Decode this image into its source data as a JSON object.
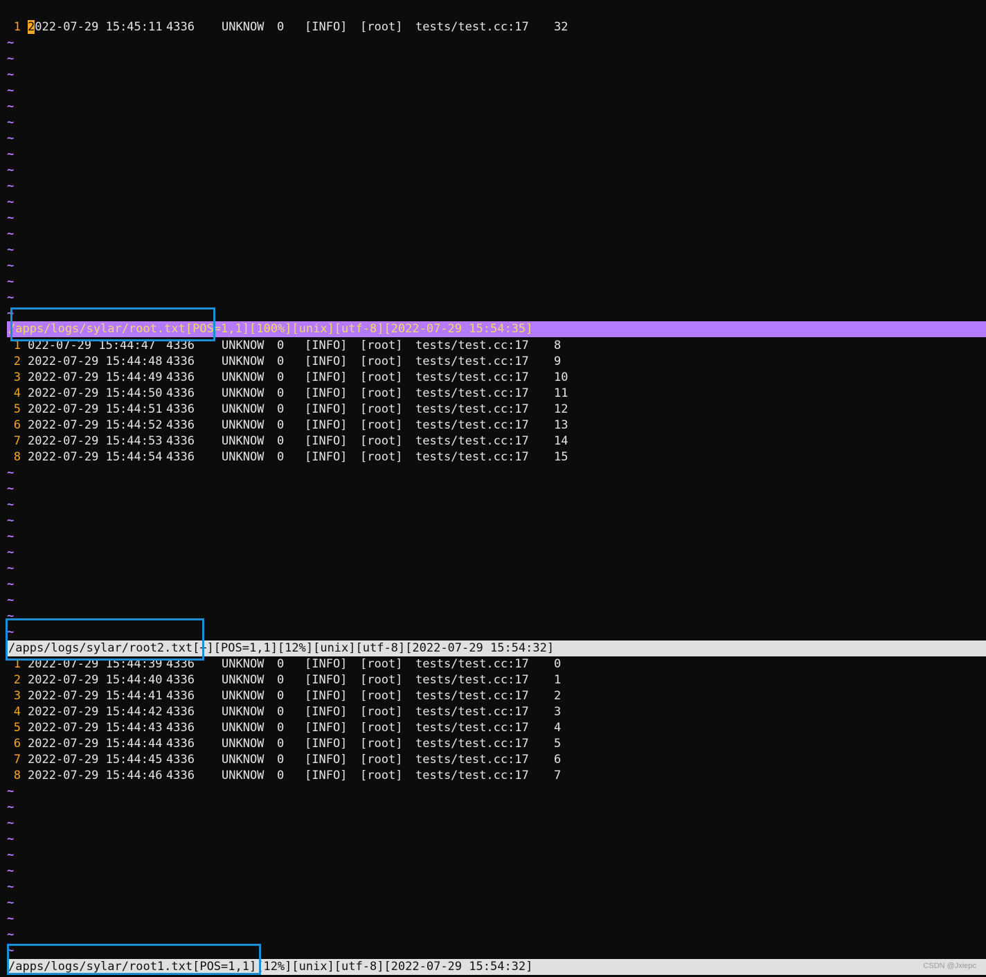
{
  "panes": [
    {
      "id": "top",
      "lines": [
        {
          "num": "1",
          "ts": "2022-07-29 15:45:11",
          "tid": "4336",
          "name": "UNKNOW",
          "zero": "0",
          "level": "[INFO]",
          "logger": "[root]",
          "file": "tests/test.cc:17",
          "val": "32"
        }
      ],
      "status": "/apps/logs/sylar/root.txt[POS=1,1][100%][unix][utf-8][2022-07-29 15:54:35]"
    },
    {
      "id": "middle",
      "lines": [
        {
          "num": "1",
          "ts": "022-07-29 15:44:47",
          "tid": "4336",
          "name": "UNKNOW",
          "zero": "0",
          "level": "[INFO]",
          "logger": "[root]",
          "file": "tests/test.cc:17",
          "val": "8"
        },
        {
          "num": "2",
          "ts": "2022-07-29 15:44:48",
          "tid": "4336",
          "name": "UNKNOW",
          "zero": "0",
          "level": "[INFO]",
          "logger": "[root]",
          "file": "tests/test.cc:17",
          "val": "9"
        },
        {
          "num": "3",
          "ts": "2022-07-29 15:44:49",
          "tid": "4336",
          "name": "UNKNOW",
          "zero": "0",
          "level": "[INFO]",
          "logger": "[root]",
          "file": "tests/test.cc:17",
          "val": "10"
        },
        {
          "num": "4",
          "ts": "2022-07-29 15:44:50",
          "tid": "4336",
          "name": "UNKNOW",
          "zero": "0",
          "level": "[INFO]",
          "logger": "[root]",
          "file": "tests/test.cc:17",
          "val": "11"
        },
        {
          "num": "5",
          "ts": "2022-07-29 15:44:51",
          "tid": "4336",
          "name": "UNKNOW",
          "zero": "0",
          "level": "[INFO]",
          "logger": "[root]",
          "file": "tests/test.cc:17",
          "val": "12"
        },
        {
          "num": "6",
          "ts": "2022-07-29 15:44:52",
          "tid": "4336",
          "name": "UNKNOW",
          "zero": "0",
          "level": "[INFO]",
          "logger": "[root]",
          "file": "tests/test.cc:17",
          "val": "13"
        },
        {
          "num": "7",
          "ts": "2022-07-29 15:44:53",
          "tid": "4336",
          "name": "UNKNOW",
          "zero": "0",
          "level": "[INFO]",
          "logger": "[root]",
          "file": "tests/test.cc:17",
          "val": "14"
        },
        {
          "num": "8",
          "ts": "2022-07-29 15:44:54",
          "tid": "4336",
          "name": "UNKNOW",
          "zero": "0",
          "level": "[INFO]",
          "logger": "[root]",
          "file": "tests/test.cc:17",
          "val": "15"
        }
      ],
      "status": "/apps/logs/sylar/root2.txt[+][POS=1,1][12%][unix][utf-8][2022-07-29 15:54:32]"
    },
    {
      "id": "bottom",
      "lines": [
        {
          "num": "1",
          "ts": "2022-07-29 15:44:39",
          "tid": "4336",
          "name": "UNKNOW",
          "zero": "0",
          "level": "[INFO]",
          "logger": "[root]",
          "file": "tests/test.cc:17",
          "val": "0"
        },
        {
          "num": "2",
          "ts": "2022-07-29 15:44:40",
          "tid": "4336",
          "name": "UNKNOW",
          "zero": "0",
          "level": "[INFO]",
          "logger": "[root]",
          "file": "tests/test.cc:17",
          "val": "1"
        },
        {
          "num": "3",
          "ts": "2022-07-29 15:44:41",
          "tid": "4336",
          "name": "UNKNOW",
          "zero": "0",
          "level": "[INFO]",
          "logger": "[root]",
          "file": "tests/test.cc:17",
          "val": "2"
        },
        {
          "num": "4",
          "ts": "2022-07-29 15:44:42",
          "tid": "4336",
          "name": "UNKNOW",
          "zero": "0",
          "level": "[INFO]",
          "logger": "[root]",
          "file": "tests/test.cc:17",
          "val": "3"
        },
        {
          "num": "5",
          "ts": "2022-07-29 15:44:43",
          "tid": "4336",
          "name": "UNKNOW",
          "zero": "0",
          "level": "[INFO]",
          "logger": "[root]",
          "file": "tests/test.cc:17",
          "val": "4"
        },
        {
          "num": "6",
          "ts": "2022-07-29 15:44:44",
          "tid": "4336",
          "name": "UNKNOW",
          "zero": "0",
          "level": "[INFO]",
          "logger": "[root]",
          "file": "tests/test.cc:17",
          "val": "5"
        },
        {
          "num": "7",
          "ts": "2022-07-29 15:44:45",
          "tid": "4336",
          "name": "UNKNOW",
          "zero": "0",
          "level": "[INFO]",
          "logger": "[root]",
          "file": "tests/test.cc:17",
          "val": "6"
        },
        {
          "num": "8",
          "ts": "2022-07-29 15:44:46",
          "tid": "4336",
          "name": "UNKNOW",
          "zero": "0",
          "level": "[INFO]",
          "logger": "[root]",
          "file": "tests/test.cc:17",
          "val": "7"
        }
      ],
      "status": "/apps/logs/sylar/root1.txt[POS=1,1][12%][unix][utf-8][2022-07-29 15:54:32]"
    }
  ],
  "tilde_char": "~",
  "watermark": "CSDN @Jxiepc",
  "colors": {
    "background": "#0c0c0c",
    "line_number": "#f6a623",
    "tilde": "#b57bff",
    "status_active_bg": "#b57bff",
    "status_active_fg": "#f8d56b",
    "status_inactive_bg": "#e0e0e0",
    "highlight_box": "#1a8fd6"
  }
}
